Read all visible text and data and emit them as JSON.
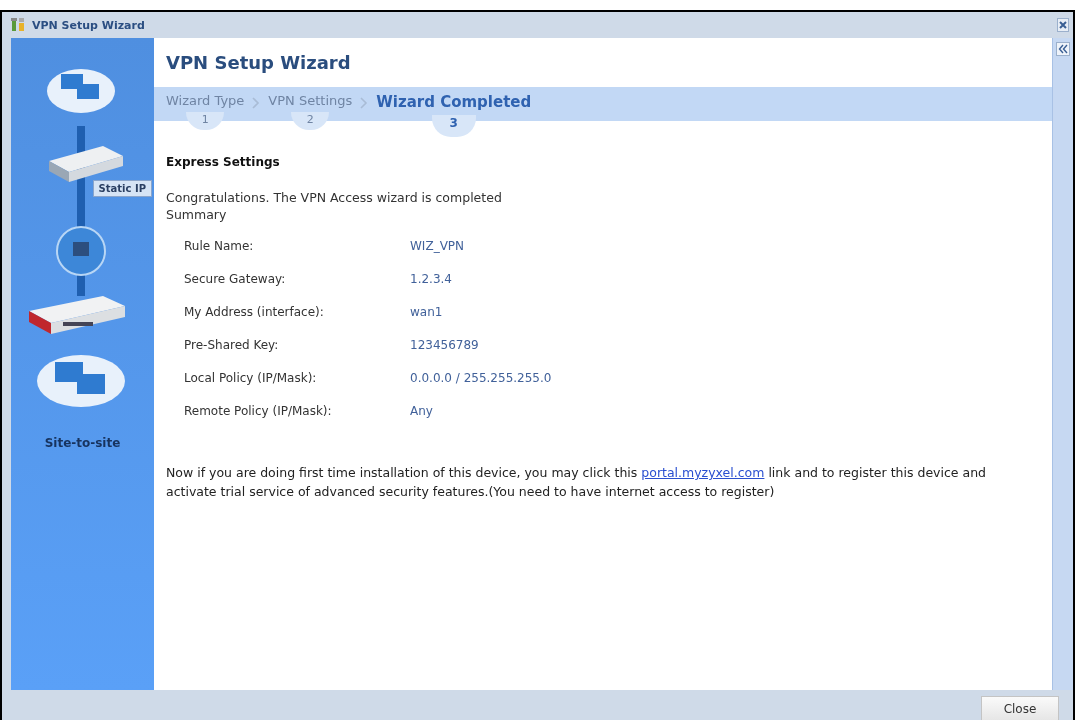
{
  "window": {
    "title": "VPN Setup Wizard"
  },
  "sidebar": {
    "connection_label": "Static IP",
    "mode_label": "Site-to-site"
  },
  "heading": "VPN Setup Wizard",
  "steps": [
    {
      "label": "Wizard Type",
      "number": "1",
      "selected": false
    },
    {
      "label": "VPN Settings",
      "number": "2",
      "selected": false
    },
    {
      "label": "Wizard Completed",
      "number": "3",
      "selected": true
    }
  ],
  "section_title": "Express Settings",
  "message": "Congratulations. The VPN Access wizard is completed",
  "summary_label": "Summary",
  "summary": [
    {
      "label": "Rule Name:",
      "value": "WIZ_VPN"
    },
    {
      "label": "Secure Gateway:",
      "value": "1.2.3.4"
    },
    {
      "label": "My Address (interface):",
      "value": "wan1"
    },
    {
      "label": "Pre-Shared Key:",
      "value": "123456789"
    },
    {
      "label": "Local Policy (IP/Mask):",
      "value": "0.0.0.0 / 255.255.255.0"
    },
    {
      "label": "Remote Policy (IP/Mask):",
      "value": "Any"
    }
  ],
  "note": {
    "before": "Now if you are doing first time installation of this device, you may click this ",
    "link": "portal.myzyxel.com",
    "after": " link and to register this device and activate trial service of advanced security features.(You need to have internet access to register)"
  },
  "buttons": [
    "Close"
  ]
}
